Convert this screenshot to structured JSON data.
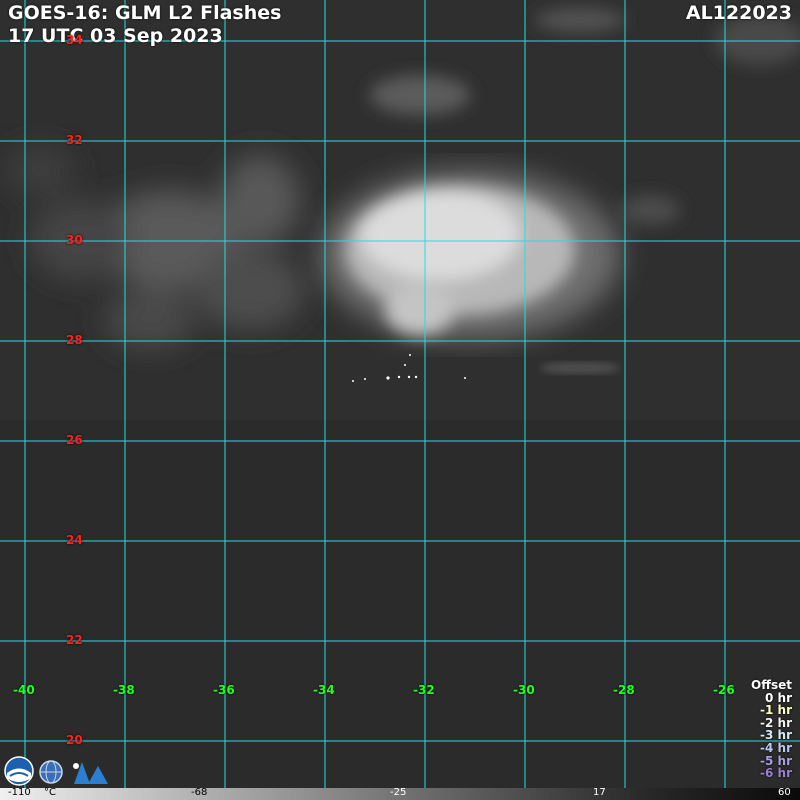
{
  "header": {
    "title_line1": "GOES-16: GLM L2 Flashes",
    "title_line2": "17 UTC 03 Sep 2023",
    "storm_id": "AL122023"
  },
  "map": {
    "grid_color": "#20e0e0",
    "lat_label_color": "#ff2020",
    "lon_label_color": "#22ff22",
    "latitude_labels": [
      "34",
      "32",
      "30",
      "28",
      "26",
      "24",
      "22",
      "20"
    ],
    "longitude_labels": [
      "-40",
      "-38",
      "-36",
      "-34",
      "-32",
      "-30",
      "-28",
      "-26"
    ]
  },
  "offset_legend": {
    "title": "Offset",
    "rows": [
      {
        "label": "0 hr",
        "color": "#ffffff"
      },
      {
        "label": "-1 hr",
        "color": "#ffffc0"
      },
      {
        "label": "-2 hr",
        "color": "#f2f2f2"
      },
      {
        "label": "-3 hr",
        "color": "#d8e8f8"
      },
      {
        "label": "-4 hr",
        "color": "#b8c8ee"
      },
      {
        "label": "-5 hr",
        "color": "#a8a0e0"
      },
      {
        "label": "-6 hr",
        "color": "#9a80d0"
      }
    ]
  },
  "colorbar": {
    "unit": "°C",
    "ticks": [
      "-110",
      "-68",
      "-25",
      "17",
      "60"
    ]
  },
  "logos": [
    "noaa-logo-icon",
    "nesdis-globe-icon",
    "cira-logo-icon"
  ]
}
